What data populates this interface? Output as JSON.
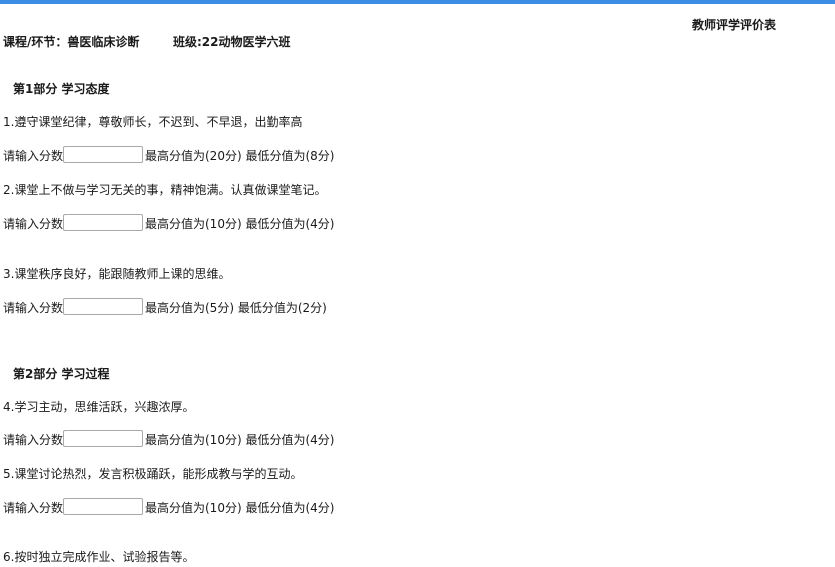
{
  "header": {
    "title": "教师评学评价表",
    "course": "课程/环节：兽医临床诊断",
    "class_info": "班级:22动物医学六班"
  },
  "sections": [
    {
      "heading": "第1部分 学习态度",
      "items": [
        {
          "question": "1.遵守课堂纪律，尊敬师长，不迟到、不早退，出勤率高",
          "prompt": "请输入分数",
          "value": "",
          "range": "最高分值为(20分) 最低分值为(8分)"
        },
        {
          "question": "2.课堂上不做与学习无关的事，精神饱满。认真做课堂笔记。",
          "prompt": "请输入分数",
          "value": "",
          "range": "最高分值为(10分) 最低分值为(4分)"
        },
        {
          "question": "3.课堂秩序良好，能跟随教师上课的思维。",
          "prompt": "请输入分数",
          "value": "",
          "range": "最高分值为(5分) 最低分值为(2分)"
        }
      ]
    },
    {
      "heading": "第2部分 学习过程",
      "items": [
        {
          "question": "4.学习主动，思维活跃，兴趣浓厚。",
          "prompt": "请输入分数",
          "value": "",
          "range": "最高分值为(10分) 最低分值为(4分)"
        },
        {
          "question": "5.课堂讨论热烈，发言积极踊跃，能形成教与学的互动。",
          "prompt": "请输入分数",
          "value": "",
          "range": "最高分值为(10分) 最低分值为(4分)"
        },
        {
          "question": "6.按时独立完成作业、试验报告等。"
        }
      ]
    }
  ]
}
